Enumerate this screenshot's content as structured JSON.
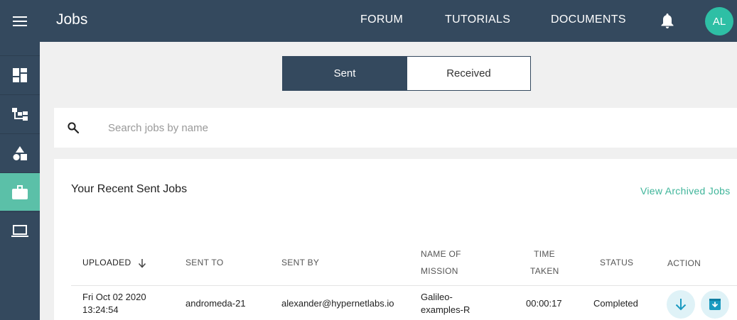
{
  "header": {
    "title": "Jobs",
    "nav": [
      "FORUM",
      "TUTORIALS",
      "DOCUMENTS"
    ],
    "avatar_initials": "AL"
  },
  "sidebar": {
    "menu_icon": "hamburger-menu-icon",
    "items": [
      {
        "icon": "dashboard-icon",
        "active": false
      },
      {
        "icon": "hierarchy-icon",
        "active": false
      },
      {
        "icon": "shapes-icon",
        "active": false
      },
      {
        "icon": "briefcase-icon",
        "active": true
      },
      {
        "icon": "laptop-icon",
        "active": false
      }
    ]
  },
  "tabs": {
    "sent": "Sent",
    "received": "Received",
    "active": "Sent"
  },
  "search": {
    "placeholder": "Search jobs by name",
    "value": ""
  },
  "jobs": {
    "title": "Your Recent Sent Jobs",
    "archived_link": "View Archived Jobs",
    "columns": {
      "uploaded": "UPLOADED",
      "sent_to": "SENT TO",
      "sent_by": "SENT BY",
      "mission_l1": "NAME OF",
      "mission_l2": "MISSION",
      "time_l1": "TIME",
      "time_l2": "TAKEN",
      "status": "STATUS",
      "action": "ACTION"
    },
    "rows": [
      {
        "uploaded_date": "Fri Oct 02 2020",
        "uploaded_time": "13:24:54",
        "sent_to": "andromeda-21",
        "sent_by": "alexander@hypernetlabs.io",
        "mission_l1": "Galileo-",
        "mission_l2": "examples-R",
        "time_taken": "00:00:17",
        "status": "Completed"
      }
    ]
  },
  "colors": {
    "primary": "#34495e",
    "accent": "#5bc0a8",
    "avatar": "#2ebfa5",
    "link": "#3fb59a",
    "action_icon": "#1a9ac0",
    "action_bg": "#dff2f7"
  }
}
